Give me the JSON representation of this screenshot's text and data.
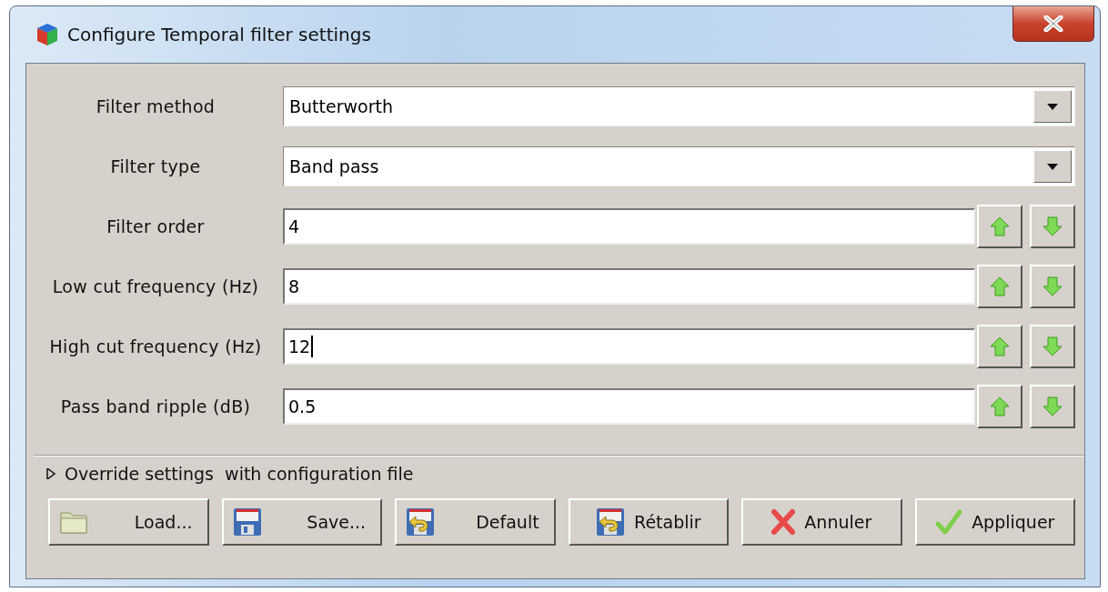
{
  "window": {
    "title": "Configure Temporal filter settings"
  },
  "fields": [
    {
      "kind": "combo",
      "label": "Filter method",
      "value": "Butterworth"
    },
    {
      "kind": "combo",
      "label": "Filter type",
      "value": "Band pass"
    },
    {
      "kind": "spin",
      "label": "Filter order",
      "value": "4",
      "focused": false
    },
    {
      "kind": "spin",
      "label": "Low cut frequency (Hz)",
      "value": "8",
      "focused": false
    },
    {
      "kind": "spin",
      "label": "High cut frequency (Hz)",
      "value": "12",
      "focused": true
    },
    {
      "kind": "spin",
      "label": "Pass band ripple (dB)",
      "value": "0.5",
      "focused": false
    }
  ],
  "expander": {
    "label": "Override settings  with configuration file",
    "expanded": false
  },
  "buttons": [
    {
      "kind": "load",
      "label": "Load..."
    },
    {
      "kind": "save",
      "label": "Save..."
    },
    {
      "kind": "default",
      "label": "Default"
    },
    {
      "kind": "restore",
      "label": "Rétablir"
    },
    {
      "kind": "cancel",
      "label": "Annuler"
    },
    {
      "kind": "apply",
      "label": "Appliquer"
    }
  ]
}
